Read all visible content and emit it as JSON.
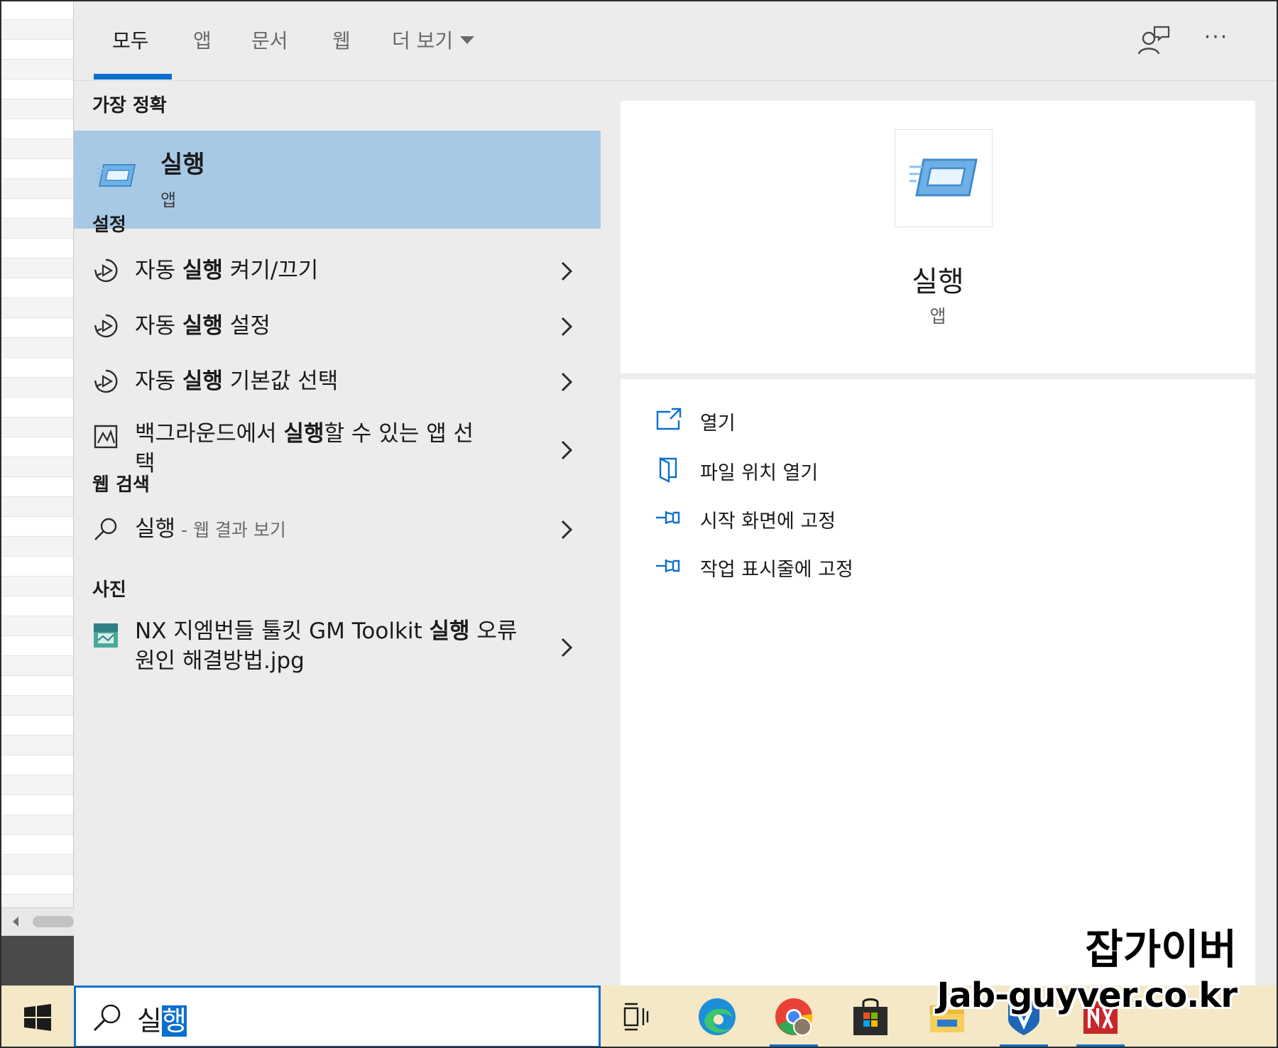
{
  "tabs": [
    {
      "label": "모두"
    },
    {
      "label": "앱"
    },
    {
      "label": "문서"
    },
    {
      "label": "웹"
    },
    {
      "label": "더 보기"
    }
  ],
  "more_options_glyph": "···",
  "best_match": {
    "heading": "가장 정확",
    "title": "실행",
    "subtitle": "앱"
  },
  "settings": {
    "heading": "설정",
    "items": [
      {
        "pre": "자동 ",
        "bold": "실행",
        "post": " 켜기/끄기",
        "icon": "autoplay-icon"
      },
      {
        "pre": "자동 ",
        "bold": "실행",
        "post": " 설정",
        "icon": "autoplay-icon"
      },
      {
        "pre": "자동 ",
        "bold": "실행",
        "post": " 기본값 선택",
        "icon": "autoplay-icon"
      },
      {
        "pre": "백그라운드에서 ",
        "bold": "실행",
        "post": "할 수 있는 앱 선택",
        "icon": "background-apps-icon"
      }
    ]
  },
  "web_search": {
    "heading": "웹 검색",
    "query": "실행",
    "hint": " - 웹 결과 보기"
  },
  "photos": {
    "heading": "사진",
    "item": {
      "pre": "NX 지엠번들 툴킷 GM Toolkit ",
      "bold": "실행",
      "post": " 오류 원인 해결방법.jpg"
    }
  },
  "preview": {
    "title": "실행",
    "subtitle": "앱",
    "actions": [
      {
        "label": "열기",
        "icon": "open-icon"
      },
      {
        "label": "파일 위치 열기",
        "icon": "file-location-icon"
      },
      {
        "label": "시작 화면에 고정",
        "icon": "pin-icon"
      },
      {
        "label": "작업 표시줄에 고정",
        "icon": "pin-icon"
      }
    ]
  },
  "search_box": {
    "typed": "실",
    "selected": "행"
  },
  "taskbar_apps": [
    "task-view-icon",
    "edge-icon",
    "chrome-icon",
    "store-icon",
    "file-explorer-icon",
    "vpn-app-icon",
    "nx-app-icon"
  ],
  "watermark": {
    "title": "잡가이버",
    "url": "Jab-guyver.co.kr"
  },
  "colors": {
    "accent": "#0b6fce",
    "selected_row": "#a8c9e6",
    "panel_bg": "#ececec",
    "taskbar_bg": "#f4e8c6"
  }
}
